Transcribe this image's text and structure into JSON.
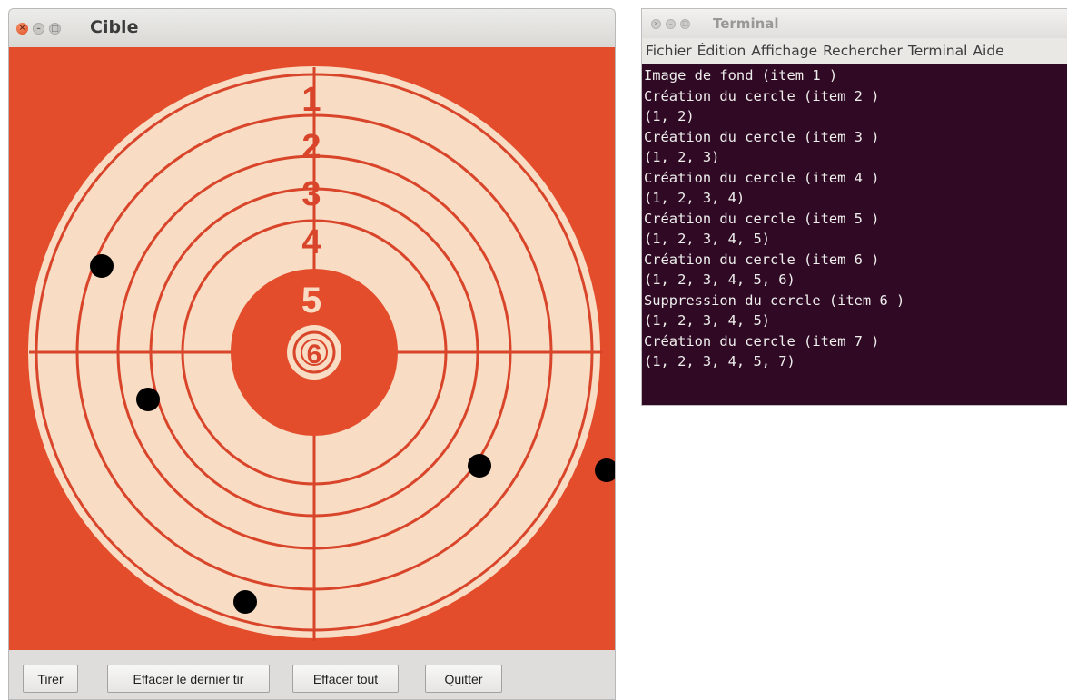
{
  "target_window": {
    "title": "Cible",
    "ring_numbers": [
      "1",
      "2",
      "3",
      "4",
      "5",
      "6"
    ],
    "colors": {
      "background": "#e34d2c",
      "paper": "#f8dcc3",
      "rings": "#d9452a",
      "shots": "#000000"
    },
    "buttons": {
      "fire": "Tirer",
      "undo_last": "Effacer le dernier tir",
      "clear_all": "Effacer tout",
      "quit": "Quitter"
    }
  },
  "terminal_window": {
    "title": "Terminal",
    "menu": [
      "Fichier",
      "Édition",
      "Affichage",
      "Rechercher",
      "Terminal",
      "Aide"
    ],
    "lines": [
      "Image de fond (item 1 )",
      "Création du cercle (item 2 )",
      "(1, 2)",
      "Création du cercle (item 3 )",
      "(1, 2, 3)",
      "Création du cercle (item 4 )",
      "(1, 2, 3, 4)",
      "Création du cercle (item 5 )",
      "(1, 2, 3, 4, 5)",
      "Création du cercle (item 6 )",
      "(1, 2, 3, 4, 5, 6)",
      "Suppression du cercle (item 6 )",
      "(1, 2, 3, 4, 5)",
      "Création du cercle (item 7 )",
      "(1, 2, 3, 4, 5, 7)"
    ],
    "colors": {
      "background": "#300a24",
      "text": "#eeeeec"
    }
  }
}
